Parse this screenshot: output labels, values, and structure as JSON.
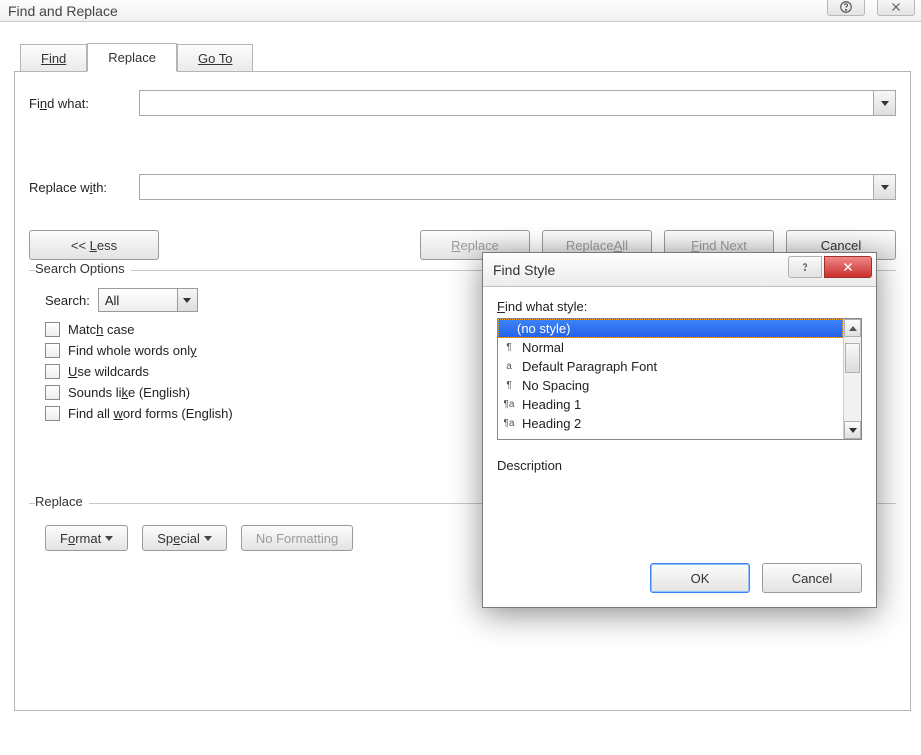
{
  "window": {
    "title": "Find and Replace"
  },
  "tabs": {
    "find": "Find",
    "replace": "Replace",
    "goto": "Go To"
  },
  "findRow": {
    "label_pre": "Fi",
    "label_u": "n",
    "label_post": "d what:",
    "value": ""
  },
  "replaceRow": {
    "label_pre": "Replace w",
    "label_u": "i",
    "label_post": "th:",
    "value": ""
  },
  "buttons": {
    "less": "<< Less",
    "replace": "Replace",
    "replaceAll": "Replace All",
    "findNext": "Find Next",
    "cancel": "Cancel"
  },
  "searchOptions": {
    "legend": "Search Options",
    "searchLabel": "Search:",
    "searchValue": "All",
    "matchCase_pre": "Matc",
    "matchCase_u": "h",
    "matchCase_post": " case",
    "wholeWords_pre": "Find whole words onl",
    "wholeWords_u": "y",
    "wholeWords_post": "",
    "wildcards_pre": "",
    "wildcards_u": "U",
    "wildcards_post": "se wildcards",
    "soundsLike_pre": "Sounds li",
    "soundsLike_u": "k",
    "soundsLike_post": "e (English)",
    "wordForms_pre": "Find all ",
    "wordForms_u": "w",
    "wordForms_post": "ord forms (English)"
  },
  "replaceSection": {
    "legend": "Replace",
    "format_pre": "F",
    "format_u": "o",
    "format_post": "rmat",
    "special_pre": "Sp",
    "special_u": "e",
    "special_post": "cial",
    "noFormatting": "No Formatting"
  },
  "modal": {
    "title": "Find Style",
    "listLabel_pre": "",
    "listLabel_u": "F",
    "listLabel_post": "ind what style:",
    "items": [
      {
        "icon": "",
        "label": "(no style)",
        "selected": true
      },
      {
        "icon": "¶",
        "label": "Normal"
      },
      {
        "icon": "a",
        "label": "Default Paragraph Font"
      },
      {
        "icon": "¶",
        "label": "No Spacing"
      },
      {
        "icon": "¶a",
        "label": "Heading 1"
      },
      {
        "icon": "¶a",
        "label": "Heading 2"
      }
    ],
    "descLabel": "Description",
    "ok": "OK",
    "cancel": "Cancel"
  }
}
